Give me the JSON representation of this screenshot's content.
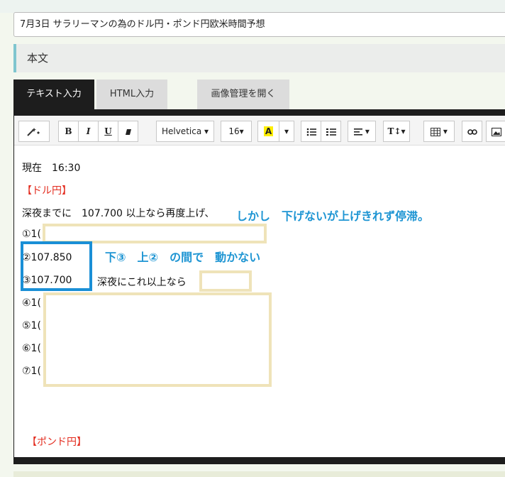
{
  "title_field": {
    "value": "7月3日 サラリーマンの為のドル円・ポンド円欧米時間予想"
  },
  "section": {
    "label": "本文"
  },
  "tabs": {
    "text": "テキスト入力",
    "html": "HTML入力",
    "images": "画像管理を開く"
  },
  "toolbar": {
    "bold": "B",
    "italic": "I",
    "underline": "U",
    "font": "Helvetica ▾",
    "size": "16▾",
    "color": "A"
  },
  "content": {
    "line1": "現在　16:30",
    "line2": "【ドル円】",
    "line3": "深夜までに　107.700 以上なら再度上げ、",
    "line4": "①1(",
    "line5": "②107.850",
    "line6": "③107.700",
    "line6b": "深夜にこれ以上なら",
    "line7": "④1(",
    "line8": "⑤1(",
    "line9": "⑥1(",
    "line10": "⑦1(",
    "line11": "【ポンド円】"
  },
  "annotations": {
    "a1": "しかし　下げないが上げきれず停滞。",
    "a2": "下③　上②　の間で　動かない"
  },
  "colors": {
    "accent": "#7fc6cf",
    "highlight_blue": "#1e95d3",
    "red_label": "#e32b1e",
    "box_blue": "#1a8fd6"
  }
}
